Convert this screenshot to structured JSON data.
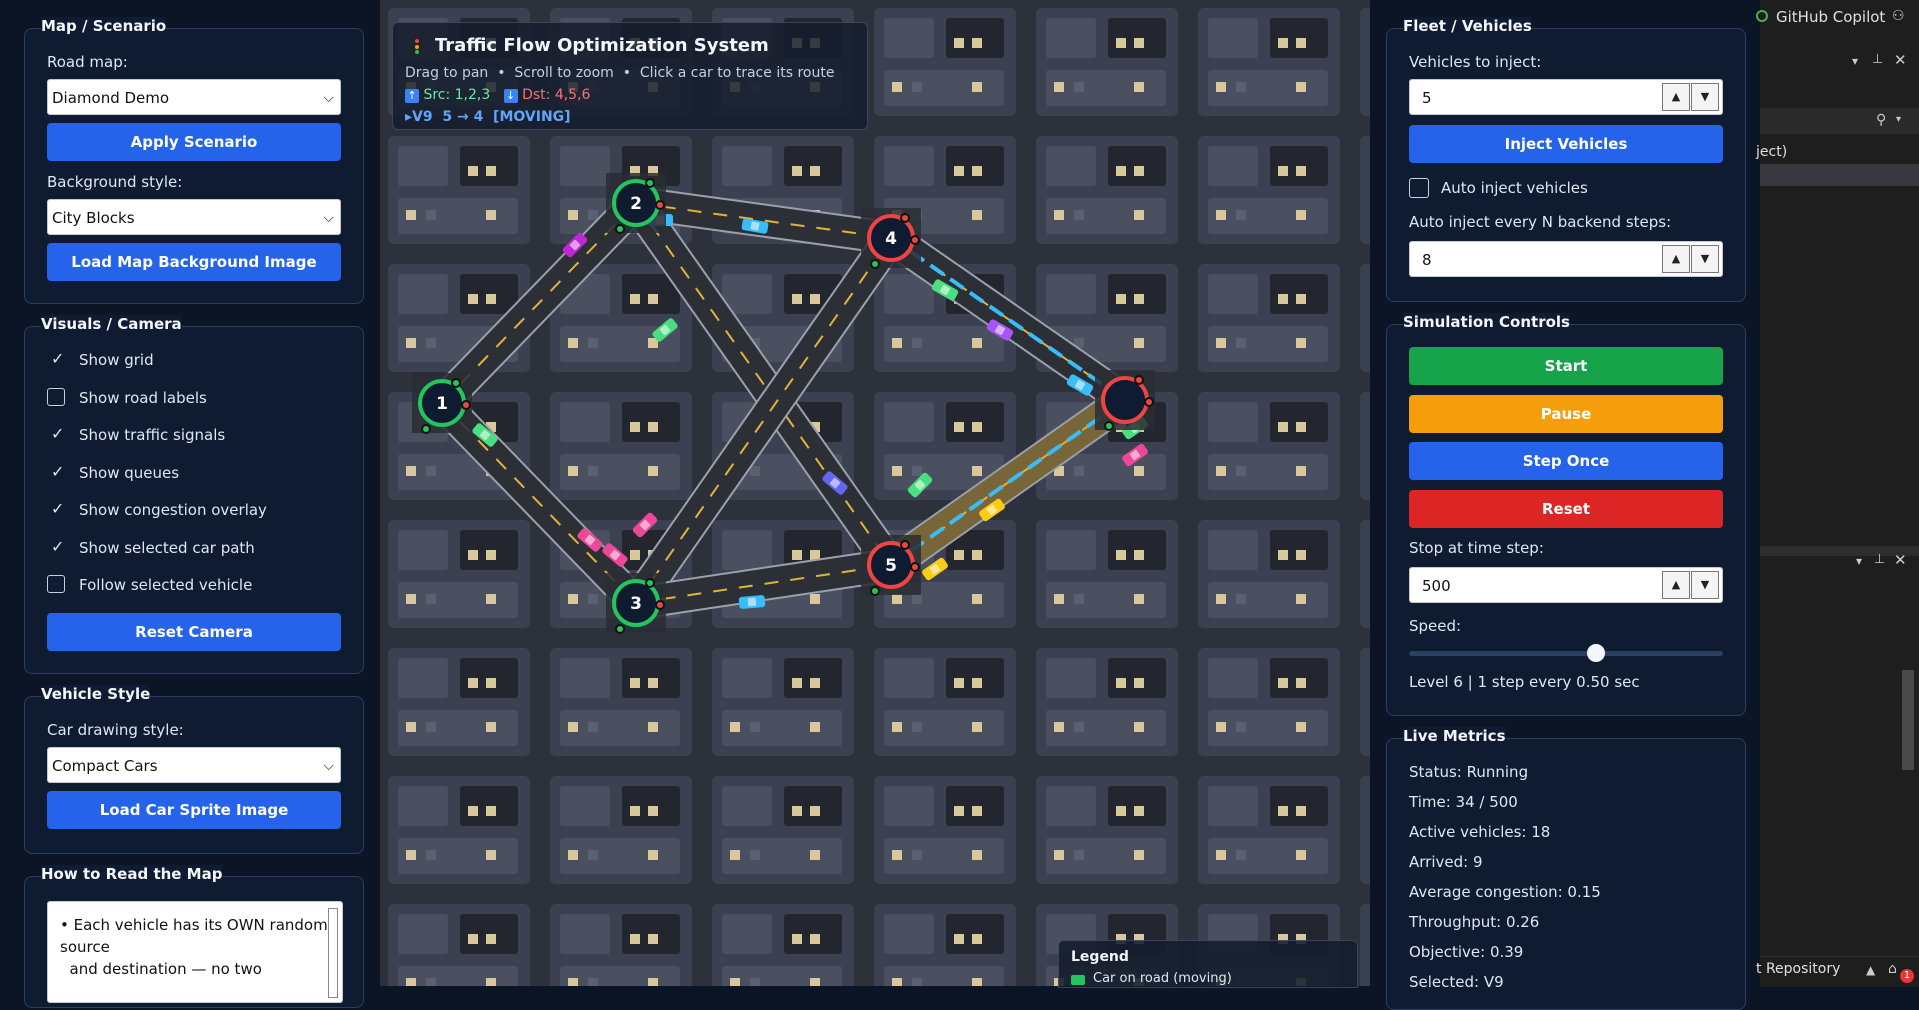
{
  "app_title": "Traffic Flow Optimization System",
  "hint": {
    "pan": "Drag to pan",
    "zoom": "Scroll to zoom",
    "trace": "Click a car to trace its route",
    "src": "Src: 1,2,3",
    "dst": "Dst: 4,5,6",
    "selected": "▸V9  5 → 4  [MOVING]"
  },
  "map_panel": {
    "title": "Map / Scenario",
    "road_map_label": "Road map:",
    "road_map_value": "Diamond Demo",
    "apply_label": "Apply Scenario",
    "bg_style_label": "Background style:",
    "bg_style_value": "City Blocks",
    "load_bg_label": "Load Map Background Image"
  },
  "visuals_panel": {
    "title": "Visuals / Camera",
    "options": [
      {
        "label": "Show grid",
        "checked": true
      },
      {
        "label": "Show road labels",
        "checked": false
      },
      {
        "label": "Show traffic signals",
        "checked": true
      },
      {
        "label": "Show queues",
        "checked": true
      },
      {
        "label": "Show congestion overlay",
        "checked": true
      },
      {
        "label": "Show selected car path",
        "checked": true
      },
      {
        "label": "Follow selected vehicle",
        "checked": false
      }
    ],
    "reset_label": "Reset Camera"
  },
  "vehicle_panel": {
    "title": "Vehicle Style",
    "style_label": "Car drawing style:",
    "style_value": "Compact Cars",
    "load_sprite_label": "Load Car Sprite Image"
  },
  "howto_panel": {
    "title": "How to Read the Map",
    "line1": "• Each vehicle has its OWN random",
    "line2": "source",
    "line3": "  and destination — no two"
  },
  "fleet_panel": {
    "title": "Fleet / Vehicles",
    "inject_label": "Vehicles to inject:",
    "inject_value": "5",
    "inject_button": "Inject Vehicles",
    "auto_label": "Auto inject vehicles",
    "every_label": "Auto inject every N backend steps:",
    "every_value": "8"
  },
  "sim_panel": {
    "title": "Simulation Controls",
    "start": "Start",
    "pause": "Pause",
    "step": "Step Once",
    "reset": "Reset",
    "stop_label": "Stop at time step:",
    "stop_value": "500",
    "speed_label": "Speed:",
    "speed_level": 6,
    "speed_max": 10,
    "speed_text": "Level 6 | 1 step every 0.50 sec"
  },
  "metrics_panel": {
    "title": "Live Metrics",
    "status": "Status: Running",
    "time": "Time: 34 / 500",
    "active": "Active vehicles: 18",
    "arrived": "Arrived: 9",
    "congestion": "Average congestion: 0.15",
    "throughput": "Throughput: 0.26",
    "objective": "Objective: 0.39",
    "selected": "Selected: V9"
  },
  "legend": {
    "title": "Legend",
    "first": "Car on road (moving)"
  },
  "nodes": [
    "1",
    "2",
    "3",
    "4",
    "5"
  ],
  "ide": {
    "copilot": "GitHub Copilot",
    "inject_frag": "ject)",
    "repo": "t Repository",
    "badge": "1"
  },
  "colors": {
    "accent_blue": "#2563eb",
    "start_green": "#16a34a",
    "pause_orange": "#f59e0b",
    "reset_red": "#dc2626",
    "node_green": "#22c55e",
    "node_red": "#ef4444",
    "path_blue": "#38bdf8"
  }
}
